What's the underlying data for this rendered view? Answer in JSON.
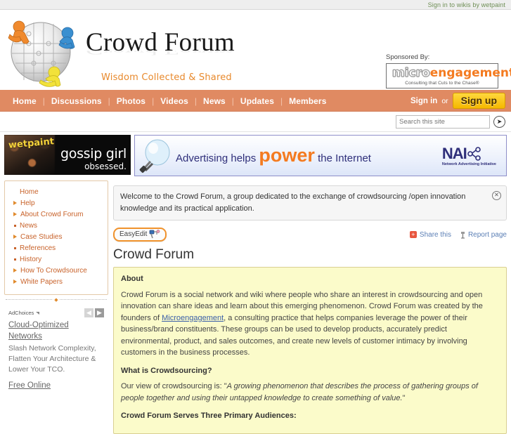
{
  "topbar": {
    "signin_wikis": "Sign in to wikis by wetpaint"
  },
  "masthead": {
    "logo_icon": "crowd-globe-puzzle-logo",
    "title": "Crowd Forum",
    "tagline": "Wisdom Collected & Shared",
    "sponsor": {
      "label": "Sponsored By:",
      "logo_part1": "micro",
      "logo_part2": "engagement",
      "tagline": "Consulting that Cuts to the Chase®"
    }
  },
  "nav": {
    "items": [
      {
        "label": "Home"
      },
      {
        "label": "Discussions"
      },
      {
        "label": "Photos"
      },
      {
        "label": "Videos"
      },
      {
        "label": "News"
      },
      {
        "label": "Updates"
      },
      {
        "label": "Members"
      }
    ],
    "separator": "|",
    "signin_label": "Sign in",
    "or_label": "or",
    "signup_label": "Sign up"
  },
  "search": {
    "placeholder": "Search this site",
    "value": "",
    "go_icon": "arrow-right-circle-icon"
  },
  "banners": {
    "gossip": {
      "brand": "wetpaint",
      "line1": "gossip girl",
      "line2": "obsessed."
    },
    "nai": {
      "icon": "lightbulb-icon",
      "text_pre": "Advertising helps ",
      "text_power": "power",
      "text_post": " the Internet",
      "logo": "NAI",
      "logo_sub": "Network Advertising Initiative"
    }
  },
  "sidebar": {
    "items": [
      {
        "label": "Home",
        "marker": "none"
      },
      {
        "label": "Help",
        "marker": "arrow"
      },
      {
        "label": "About Crowd Forum",
        "marker": "arrow"
      },
      {
        "label": "News",
        "marker": "dot"
      },
      {
        "label": "Case Studies",
        "marker": "arrow"
      },
      {
        "label": "References",
        "marker": "dot"
      },
      {
        "label": "History",
        "marker": "dot"
      },
      {
        "label": "How To Crowdsource",
        "marker": "arrow"
      },
      {
        "label": "White Papers",
        "marker": "arrow"
      }
    ],
    "ad": {
      "adchoices_label": "AdChoices",
      "prev_icon": "chevron-left-icon",
      "next_icon": "chevron-right-icon",
      "prev_glyph": "◀",
      "next_glyph": "▶",
      "title": "Cloud-Optimized Networks",
      "body": "Slash Network Complexity, Flatten Your Architecture & Lower Your TCO.",
      "title2": "Free Online"
    }
  },
  "content": {
    "welcome": "Welcome to the Crowd Forum, a group dedicated to the exchange of crowdsourcing /open innovation knowledge and its practical application.",
    "welcome_close_icon": "close-circle-icon",
    "easyedit_label": "EasyEdit",
    "easyedit_icon": "paint-roller-icon",
    "share_label": "Share this",
    "share_icon": "plus-square-icon",
    "report_label": "Report page",
    "report_icon": "flag-icon",
    "page_title": "Crowd Forum",
    "sections": [
      {
        "heading": "About",
        "paragraph_pre": "Crowd Forum is a social network and wiki where people who share an interest in crowdsourcing and open innovation can share ideas and learn about this emerging phenomenon. Crowd Forum was created by the founders of ",
        "link": "Microengagement",
        "paragraph_post": ", a consulting practice that helps companies leverage the power of their business/brand constituents. These groups can be used to develop products, accurately predict environmental, product, and sales outcomes, and create new levels of customer intimacy by involving customers in the business processes."
      },
      {
        "heading": "What is Crowdsourcing?",
        "paragraph_pre": "Our view of crowdsourcing is: \"",
        "quote": "A growing phenomenon that describes the process of gathering groups of people together and using their untapped knowledge to create something of value.",
        "paragraph_post": "\""
      },
      {
        "heading": "Crowd Forum Serves Three Primary Audiences:"
      }
    ]
  },
  "colors": {
    "nav_bar": "#e08a62",
    "brand_orange": "#e8892c",
    "signup_yellow": "#f5b800",
    "article_bg": "#fbfbca",
    "sidebar_link": "#c8622a"
  }
}
